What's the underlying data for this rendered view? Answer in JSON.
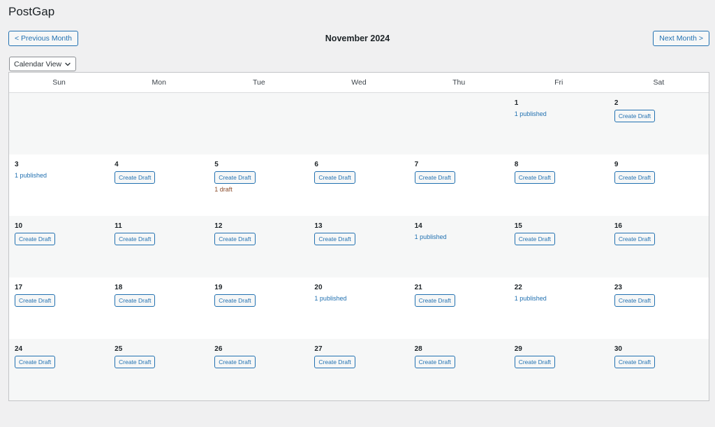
{
  "app": {
    "title": "PostGap"
  },
  "nav": {
    "prev_label": "< Previous Month",
    "next_label": "Next Month >",
    "month_title": "November 2024"
  },
  "view_select": {
    "label": "Calendar View",
    "icon": "chevron-down-icon"
  },
  "calendar": {
    "weekdays": [
      "Sun",
      "Mon",
      "Tue",
      "Wed",
      "Thu",
      "Fri",
      "Sat"
    ],
    "create_label": "Create Draft",
    "weeks": [
      [
        {
          "day": ""
        },
        {
          "day": ""
        },
        {
          "day": ""
        },
        {
          "day": ""
        },
        {
          "day": ""
        },
        {
          "day": "1",
          "published": "1 published"
        },
        {
          "day": "2",
          "create": true
        }
      ],
      [
        {
          "day": "3",
          "published": "1 published"
        },
        {
          "day": "4",
          "create": true
        },
        {
          "day": "5",
          "create": true,
          "draft": "1 draft"
        },
        {
          "day": "6",
          "create": true
        },
        {
          "day": "7",
          "create": true
        },
        {
          "day": "8",
          "create": true
        },
        {
          "day": "9",
          "create": true
        }
      ],
      [
        {
          "day": "10",
          "create": true
        },
        {
          "day": "11",
          "create": true
        },
        {
          "day": "12",
          "create": true
        },
        {
          "day": "13",
          "create": true
        },
        {
          "day": "14",
          "published": "1 published"
        },
        {
          "day": "15",
          "create": true
        },
        {
          "day": "16",
          "create": true
        }
      ],
      [
        {
          "day": "17",
          "create": true
        },
        {
          "day": "18",
          "create": true
        },
        {
          "day": "19",
          "create": true
        },
        {
          "day": "20",
          "published": "1 published"
        },
        {
          "day": "21",
          "create": true
        },
        {
          "day": "22",
          "published": "1 published"
        },
        {
          "day": "23",
          "create": true
        }
      ],
      [
        {
          "day": "24",
          "create": true
        },
        {
          "day": "25",
          "create": true
        },
        {
          "day": "26",
          "create": true
        },
        {
          "day": "27",
          "create": true
        },
        {
          "day": "28",
          "create": true
        },
        {
          "day": "29",
          "create": true
        },
        {
          "day": "30",
          "create": true
        }
      ]
    ]
  },
  "colors": {
    "accent": "#2271b1",
    "draft": "#8a4b2a",
    "background": "#f0f0f1",
    "shaded_row": "#f6f7f7"
  }
}
